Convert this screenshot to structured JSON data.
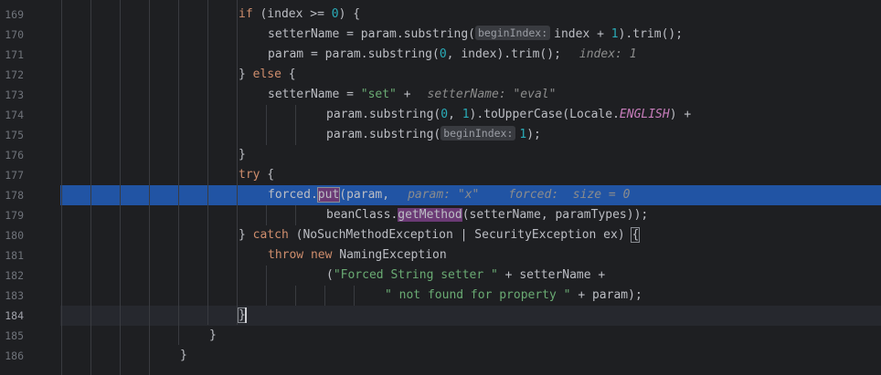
{
  "gutter": {
    "line_numbers": [
      "169",
      "170",
      "171",
      "172",
      "173",
      "174",
      "175",
      "176",
      "177",
      "178",
      "179",
      "180",
      "181",
      "182",
      "183",
      "184",
      "185",
      "186"
    ]
  },
  "code": {
    "l169": {
      "kw_if": "if",
      "a": " (index >= ",
      "zero": "0",
      "b": ") {"
    },
    "l170": {
      "a": "setterName = param.substring(",
      "hint": "beginIndex:",
      "b": "index + ",
      "one": "1",
      "c": ").trim();"
    },
    "l171": {
      "a": "param = param.substring(",
      "zero": "0",
      "b": ", index).trim();",
      "debug": "index: 1"
    },
    "l172": {
      "a": "} ",
      "kw_else": "else",
      "b": " {"
    },
    "l173": {
      "a": "setterName = ",
      "str": "\"set\"",
      "b": " +",
      "debug": "setterName: \"eval\""
    },
    "l174": {
      "a": "param.substring(",
      "zero": "0",
      "b": ", ",
      "one": "1",
      "c": ").toUpperCase(Locale.",
      "const": "ENGLISH",
      "d": ") +"
    },
    "l175": {
      "a": "param.substring(",
      "hint": "beginIndex:",
      "one": "1",
      "b": ");"
    },
    "l176": {
      "a": "}"
    },
    "l177": {
      "kw_try": "try",
      "b": " {"
    },
    "l178": {
      "a": "forced.",
      "call": "put",
      "b": "(param,",
      "debug1": "param: \"x\"",
      "debug2": "forced:  size = 0"
    },
    "l179": {
      "a": "beanClass.",
      "call": "getMethod",
      "b": "(setterName, paramTypes));"
    },
    "l180": {
      "a": "} ",
      "kw_catch": "catch",
      "b": " (NoSuchMethodException | SecurityException ex) ",
      "brace": "{"
    },
    "l181": {
      "kw_throw": "throw",
      "sp": " ",
      "kw_new": "new",
      "b": " NamingException"
    },
    "l182": {
      "a": "(",
      "str": "\"Forced String setter \"",
      "b": " + setterName +"
    },
    "l183": {
      "str": "\" not found for property \"",
      "b": " + param);"
    },
    "l184": {
      "brace": "}"
    },
    "l185": {
      "a": "}"
    },
    "l186": {
      "a": "}"
    }
  }
}
